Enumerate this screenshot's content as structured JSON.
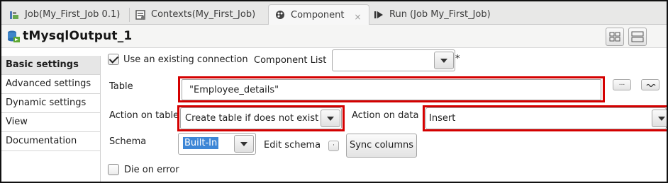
{
  "tabs": [
    {
      "label": "Job(My_First_Job 0.1)",
      "icon": "job-icon",
      "active": false
    },
    {
      "label": "Contexts(My_First_Job)",
      "icon": "contexts-icon",
      "active": false
    },
    {
      "label": "Component",
      "icon": "component-icon",
      "active": true,
      "close": "×"
    },
    {
      "label": "Run (Job My_First_Job)",
      "icon": "run-icon",
      "active": false
    }
  ],
  "header": {
    "title": "tMysqlOutput_1",
    "icon": "mysql-database-icon"
  },
  "sidebar": {
    "items": [
      {
        "label": "Basic settings",
        "active": true
      },
      {
        "label": "Advanced settings"
      },
      {
        "label": "Dynamic settings"
      },
      {
        "label": "View"
      },
      {
        "label": "Documentation"
      }
    ]
  },
  "form": {
    "use_connection_label": "Use an existing connection",
    "use_connection_checked": true,
    "component_list_label": "Component List",
    "component_list_value": "",
    "required_mark": "*",
    "table_label": "Table",
    "table_value": "\"Employee_details\"",
    "ellipsis_button": "...",
    "action_on_table_label": "Action on table",
    "action_on_table_value": "Create table if does not exist",
    "action_on_data_label": "Action on data",
    "action_on_data_value": "Insert",
    "schema_label": "Schema",
    "schema_value": "Built-In",
    "edit_schema_label": "Edit schema",
    "sync_columns_label": "Sync columns",
    "die_on_error_label": "Die on error",
    "die_on_error_checked": false
  },
  "colors": {
    "highlight": "#d40000",
    "selection": "#3d86d6"
  }
}
